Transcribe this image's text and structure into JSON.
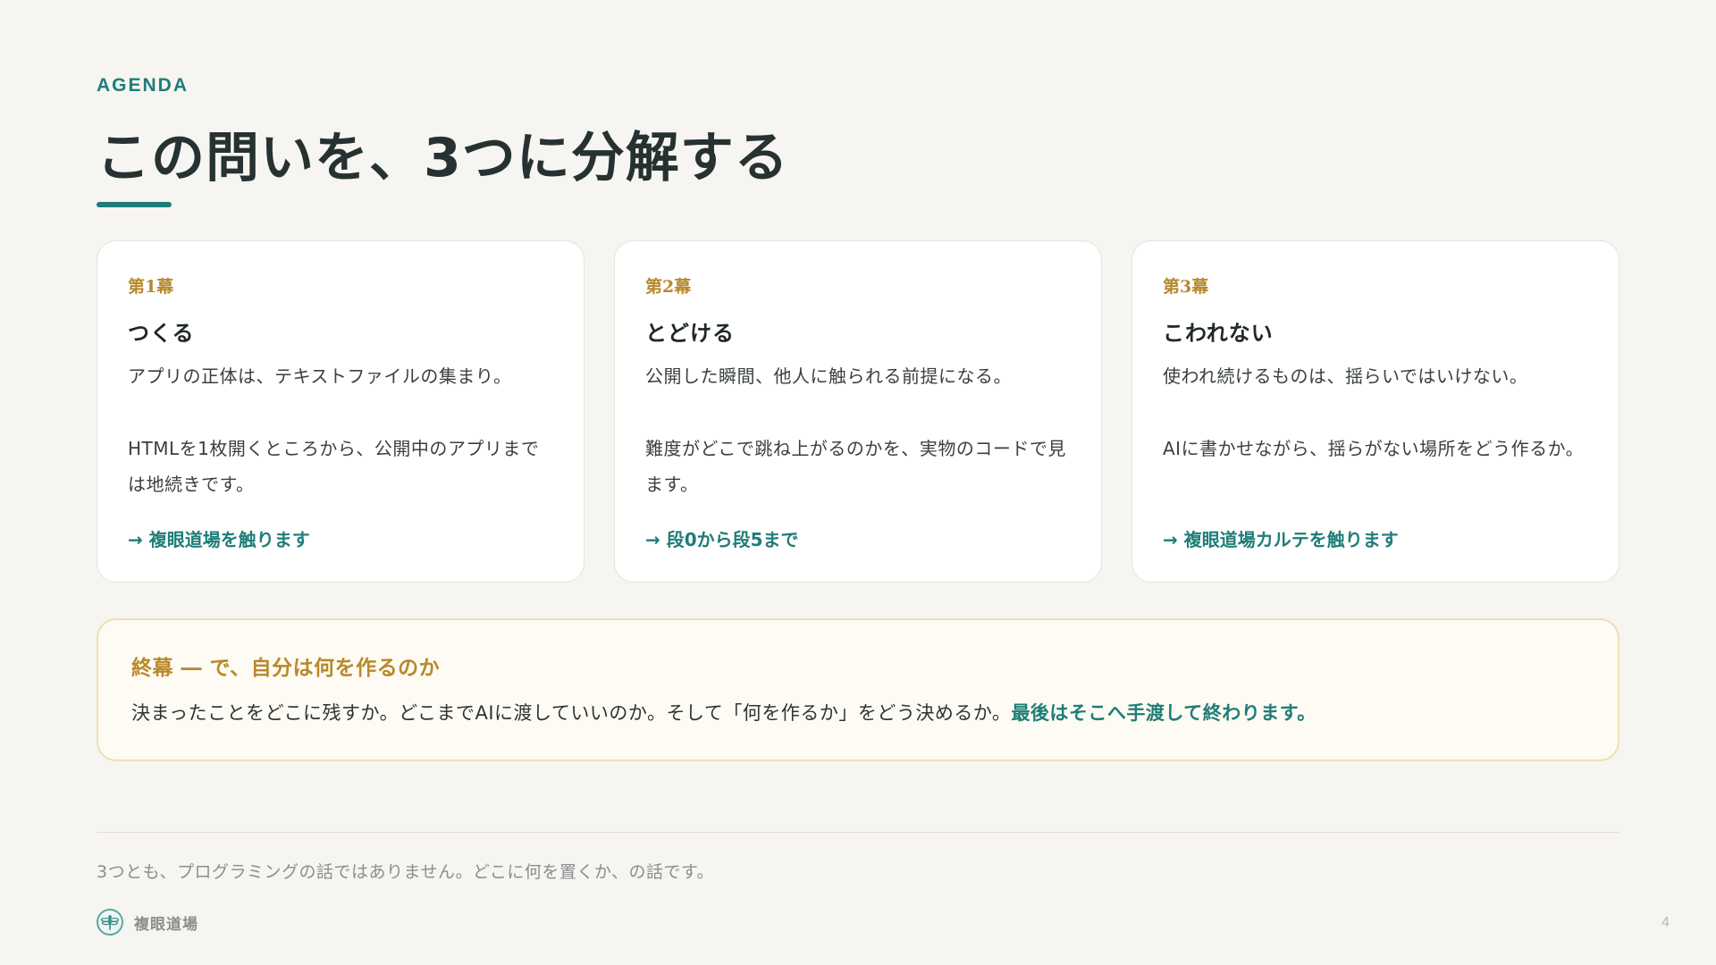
{
  "header": {
    "eyebrow": "AGENDA",
    "title": "この問いを、3つに分解する"
  },
  "cards": [
    {
      "act": "第1幕",
      "title": "つくる",
      "lead": "アプリの正体は、テキストファイルの集まり。",
      "body": "HTMLを1枚開くところから、公開中のアプリまでは地続きです。",
      "link": "→ 複眼道場を触ります"
    },
    {
      "act": "第2幕",
      "title": "とどける",
      "lead": "公開した瞬間、他人に触られる前提になる。",
      "body": "難度がどこで跳ね上がるのかを、実物のコードで見ます。",
      "link": "→ 段0から段5まで"
    },
    {
      "act": "第3幕",
      "title": "こわれない",
      "lead": "使われ続けるものは、揺らいではいけない。",
      "body": "AIに書かせながら、揺らがない場所をどう作るか。",
      "link": "→ 複眼道場カルテを触ります"
    }
  ],
  "finale": {
    "title": "終幕 ― で、自分は何を作るのか",
    "text": "決まったことをどこに残すか。どこまでAIに渡していいのか。そして「何を作るか」をどう決めるか。",
    "emphasis": "最後はそこへ手渡して終わります。"
  },
  "footer": {
    "note": "3つとも、プログラミングの話ではありません。どこに何を置くか、の話です。",
    "brand": "複眼道場",
    "brand_icon": "dragonfly-icon",
    "page_number": "4"
  },
  "colors": {
    "accent": "#1f7d78",
    "gold": "#b8892c",
    "background": "#f6f5f1"
  }
}
